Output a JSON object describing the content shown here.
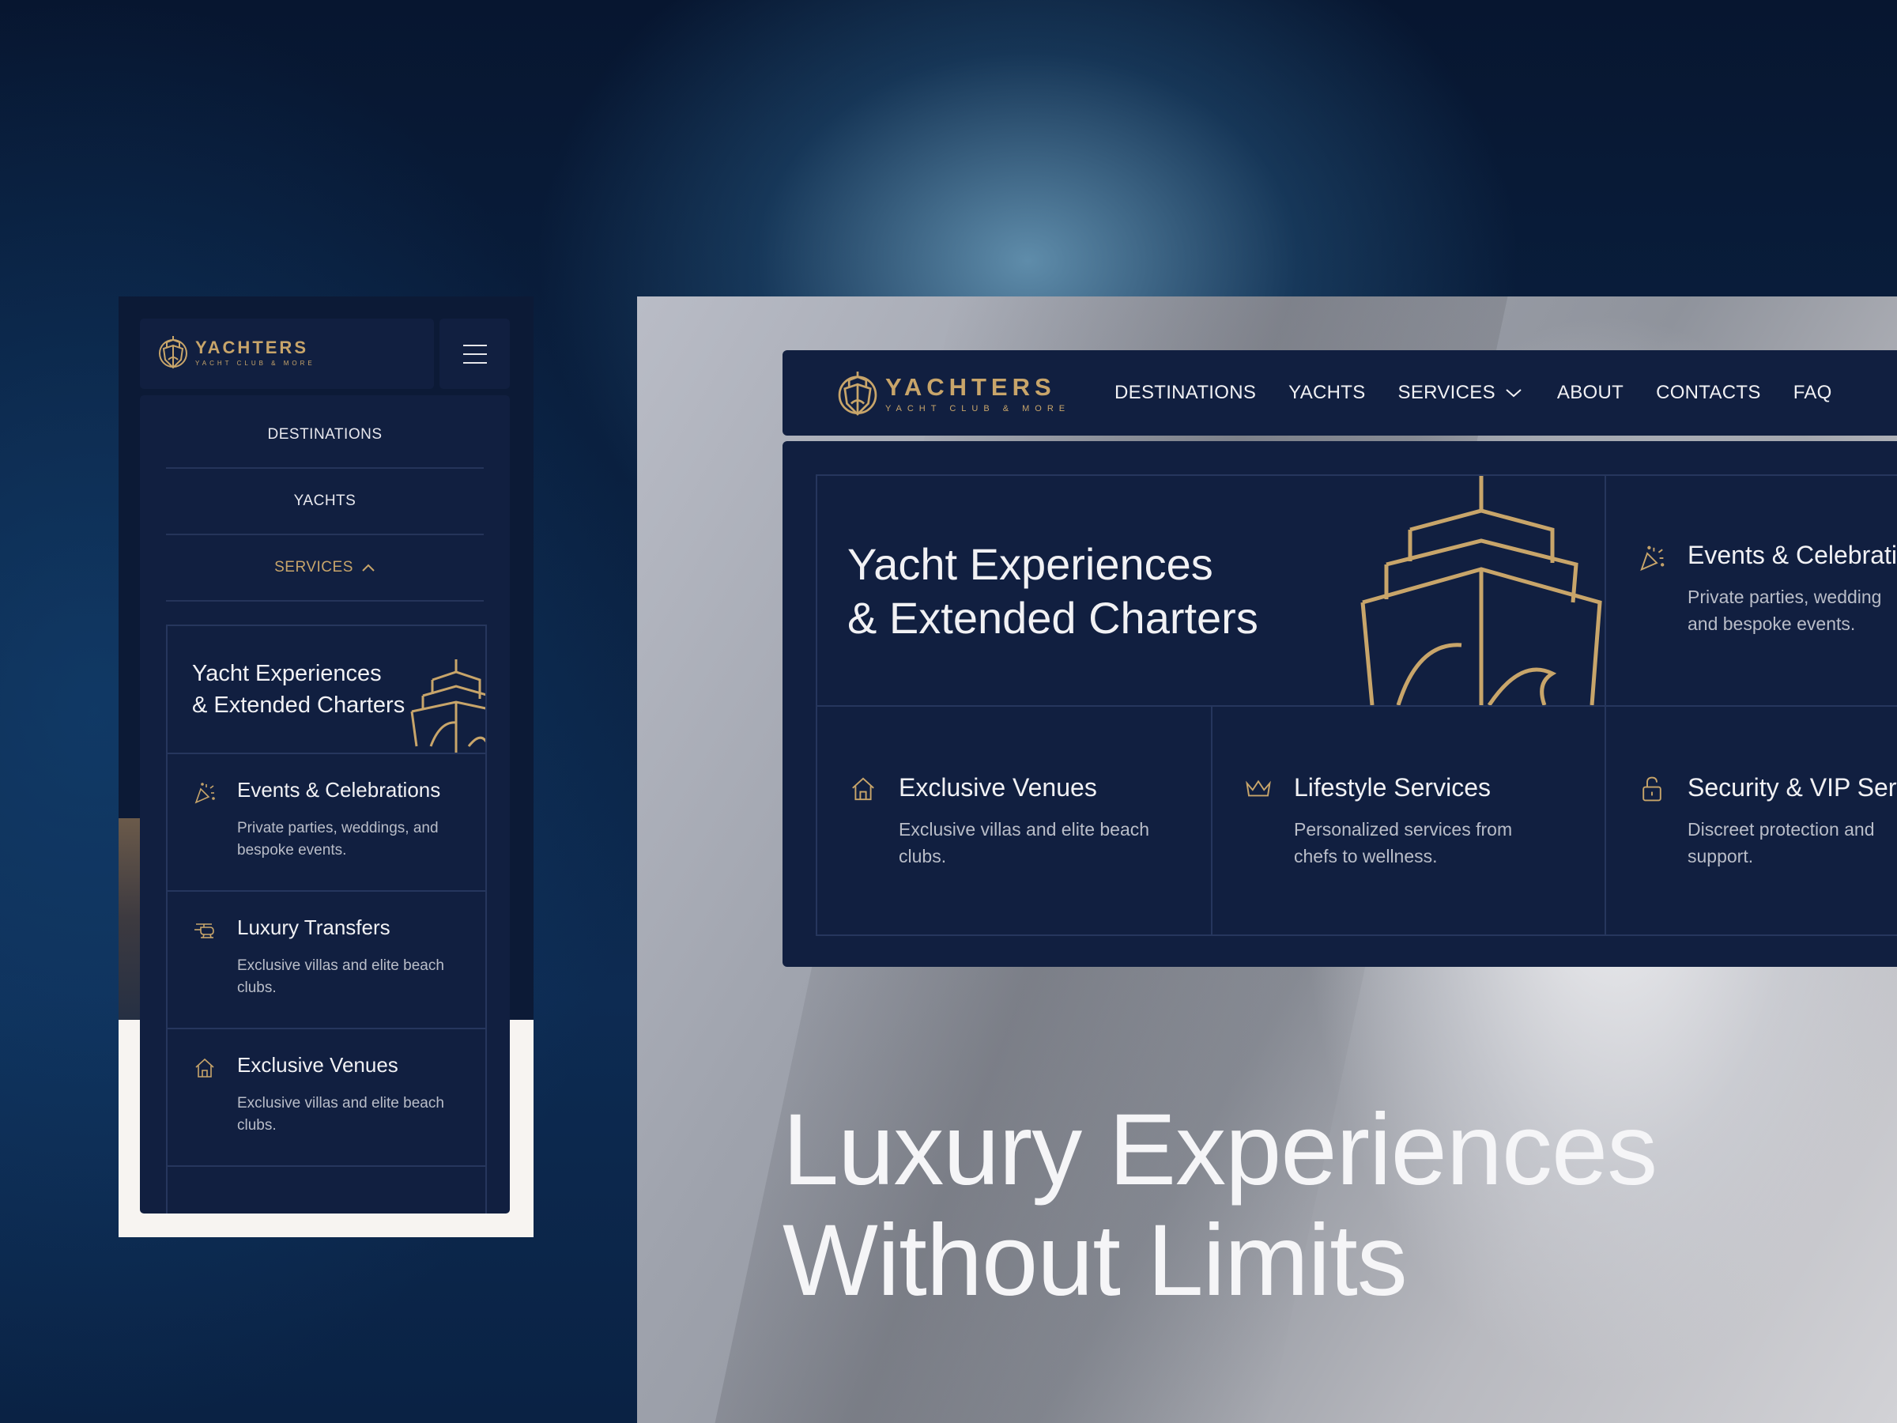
{
  "brand": {
    "name": "YACHTERS",
    "tagline": "YACHT CLUB & MORE",
    "accent_color": "#c8a56a",
    "navy": "#111f40"
  },
  "mobile": {
    "menu_icon": "hamburger-icon",
    "nav": [
      {
        "label": "DESTINATIONS"
      },
      {
        "label": "YACHTS"
      },
      {
        "label": "SERVICES",
        "expanded": true
      }
    ],
    "feature": {
      "line1": "Yacht Experiences",
      "line2": "& Extended Charters"
    },
    "items": [
      {
        "icon": "party-popper-icon",
        "title": "Events & Celebrations",
        "desc": "Private parties, weddings, and bespoke events."
      },
      {
        "icon": "helicopter-icon",
        "title": "Luxury Transfers",
        "desc": "Exclusive villas and elite beach clubs."
      },
      {
        "icon": "home-icon",
        "title": "Exclusive Venues",
        "desc": "Exclusive villas and elite beach clubs."
      }
    ]
  },
  "desktop": {
    "nav": [
      {
        "label": "DESTINATIONS"
      },
      {
        "label": "YACHTS"
      },
      {
        "label": "SERVICES",
        "has_dropdown": true
      },
      {
        "label": "ABOUT"
      },
      {
        "label": "CONTACTS"
      },
      {
        "label": "FAQ"
      }
    ],
    "feature": {
      "line1": "Yacht Experiences",
      "line2": "& Extended Charters"
    },
    "events": {
      "icon": "party-popper-icon",
      "title": "Events & Celebrati",
      "desc1": "Private parties, wedding",
      "desc2": "and bespoke events."
    },
    "venues": {
      "icon": "home-icon",
      "title": "Exclusive Venues",
      "desc1": "Exclusive villas and elite beach",
      "desc2": "clubs."
    },
    "lifestyle": {
      "icon": "crown-icon",
      "title": "Lifestyle Services",
      "desc1": "Personalized services from",
      "desc2": "chefs to wellness."
    },
    "security": {
      "icon": "unlock-icon",
      "title": "Security & VIP Serv",
      "desc1": "Discreet protection and",
      "desc2": "support."
    },
    "hero": {
      "line1": "Luxury Experiences",
      "line2": "Without Limits"
    }
  }
}
